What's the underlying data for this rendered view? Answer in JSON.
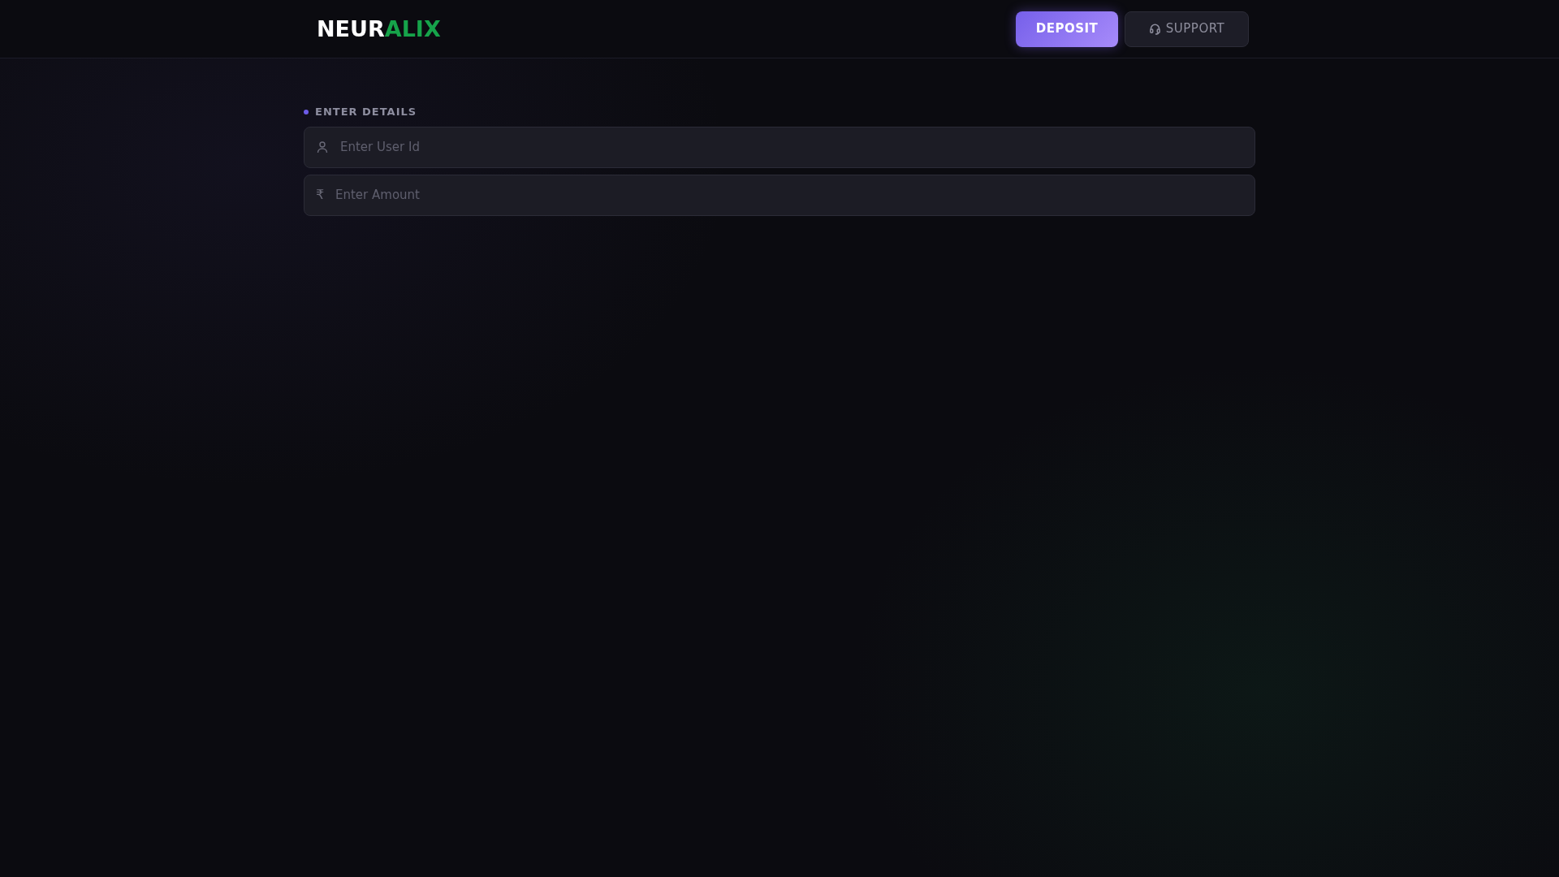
{
  "header": {
    "logo": [
      {
        "text": "NEUR",
        "color": "#ffffff"
      },
      {
        "text": "ALIX",
        "color": "#16a34a"
      }
    ],
    "buttons": [
      {
        "label": "DEPOSIT",
        "kind": "primary"
      },
      {
        "label": "SUPPORT",
        "kind": "support"
      }
    ]
  },
  "form": {
    "section_label": "ENTER DETAILS",
    "fields": [
      {
        "kind": "user",
        "placeholder": "Enter User Id"
      },
      {
        "kind": "amount",
        "symbol": "₹",
        "placeholder": "Enter Amount"
      }
    ]
  }
}
